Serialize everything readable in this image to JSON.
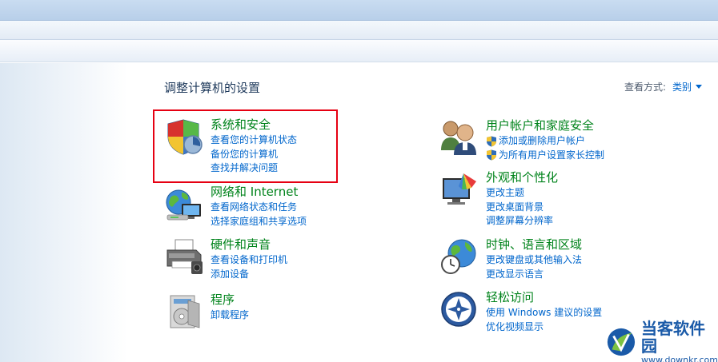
{
  "page": {
    "title": "调整计算机的设置",
    "view_by_label": "查看方式:",
    "view_by_value": "类别"
  },
  "categories": [
    {
      "title": "系统和安全",
      "icon": "shield-icon",
      "links": [
        "查看您的计算机状态",
        "备份您的计算机",
        "查找并解决问题"
      ]
    },
    {
      "title": "网络和 Internet",
      "icon": "network-icon",
      "links": [
        "查看网络状态和任务",
        "选择家庭组和共享选项"
      ]
    },
    {
      "title": "硬件和声音",
      "icon": "printer-icon",
      "links": [
        "查看设备和打印机",
        "添加设备"
      ]
    },
    {
      "title": "程序",
      "icon": "programs-icon",
      "links": [
        "卸载程序"
      ]
    },
    {
      "title": "用户帐户和家庭安全",
      "icon": "users-icon",
      "links": [
        "添加或删除用户帐户",
        "为所有用户设置家长控制"
      ]
    },
    {
      "title": "外观和个性化",
      "icon": "appearance-icon",
      "links": [
        "更改主题",
        "更改桌面背景",
        "调整屏幕分辨率"
      ]
    },
    {
      "title": "时钟、语言和区域",
      "icon": "clock-globe-icon",
      "links": [
        "更改键盘或其他输入法",
        "更改显示语言"
      ]
    },
    {
      "title": "轻松访问",
      "icon": "ease-of-access-icon",
      "links": [
        "使用 Windows 建议的设置",
        "优化视频显示"
      ]
    }
  ],
  "watermark": {
    "name": "当客软件园",
    "url": "www.downkr.com"
  },
  "colors": {
    "category_title": "#00831b",
    "link": "#0066cc",
    "highlight": "#e60012"
  }
}
